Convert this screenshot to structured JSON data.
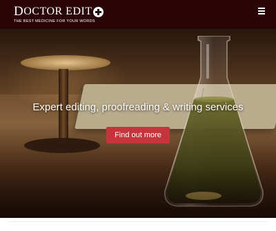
{
  "header": {
    "logo_title_first": "D",
    "logo_title_rest": "OCTOR EDIT",
    "logo_tagline": "THE BEST MEDICINE FOR YOUR WORDS",
    "menu_icon": "hamburger-menu-icon",
    "background_color": "#2a0508"
  },
  "hero": {
    "headline": "Expert editing, proofreading & writing services",
    "cta_label": "Find out more",
    "cta_color": "#c4343b"
  }
}
